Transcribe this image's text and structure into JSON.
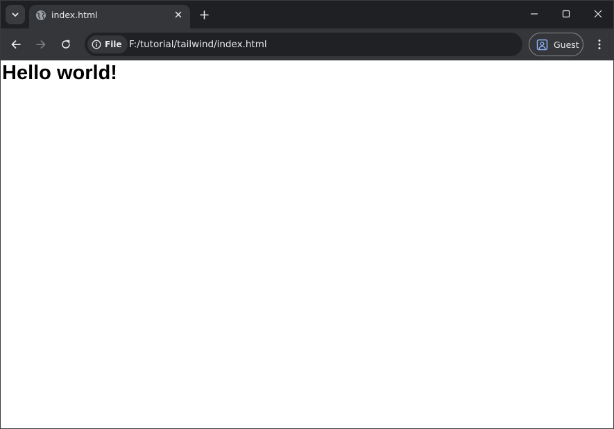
{
  "browser": {
    "tabs": [
      {
        "title": "index.html",
        "active": true,
        "favicon": "globe-icon"
      }
    ],
    "address_bar": {
      "chip_label": "File",
      "chip_icon": "info-icon",
      "url": "F:/tutorial/tailwind/index.html"
    },
    "profile": {
      "label": "Guest",
      "icon": "guest-profile-icon"
    },
    "colors": {
      "frame": "#1f2023",
      "toolbar": "#35363a",
      "omnibox": "#202124",
      "text": "#e8eaed"
    }
  },
  "page": {
    "heading": "Hello world!",
    "background": "#ffffff"
  }
}
